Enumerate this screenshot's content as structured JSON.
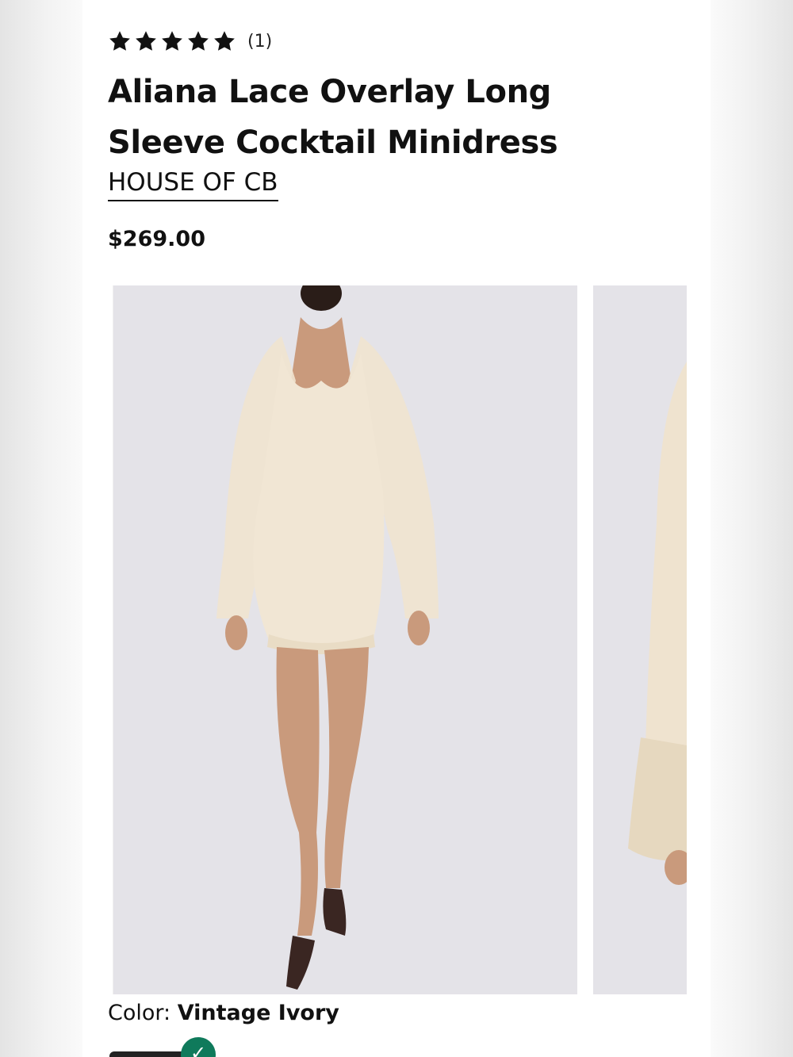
{
  "product": {
    "rating_stars": 5,
    "review_count": "(1)",
    "title": "Aliana Lace Overlay Long Sleeve Cocktail Minidress",
    "brand": "HOUSE OF CB",
    "price": "$269.00"
  },
  "gallery": {
    "images": [
      {
        "name": "front-view",
        "alt": ""
      },
      {
        "name": "sleeve-detail",
        "alt": ""
      }
    ]
  },
  "color": {
    "label": "Color:",
    "value": "Vintage Ivory"
  },
  "colors": {
    "star": "#111111",
    "selected_check": "#0f7a5b",
    "photo_background": "#e3e2e7",
    "dress": "#efe4d2"
  }
}
